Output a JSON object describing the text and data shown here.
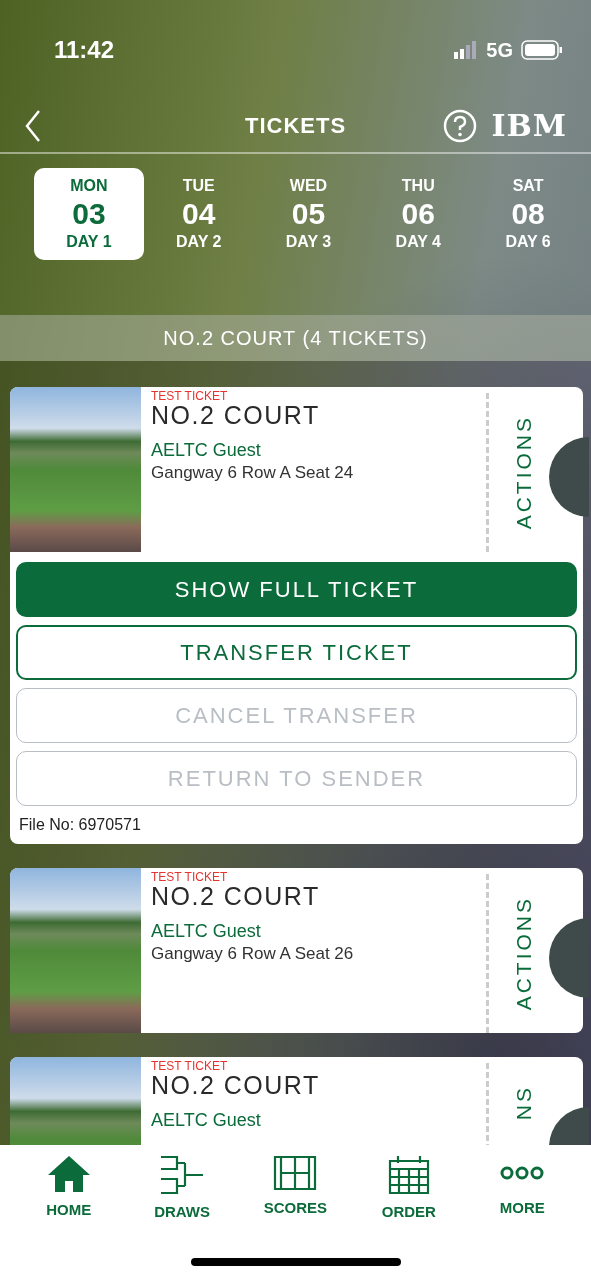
{
  "status_bar": {
    "time": "11:42",
    "network": "5G"
  },
  "header": {
    "title": "TICKETS",
    "logo": "IBM"
  },
  "days": [
    {
      "weekday": "MON",
      "date": "03",
      "day": "DAY 1",
      "selected": true
    },
    {
      "weekday": "TUE",
      "date": "04",
      "day": "DAY 2",
      "selected": false
    },
    {
      "weekday": "WED",
      "date": "05",
      "day": "DAY 3",
      "selected": false
    },
    {
      "weekday": "THU",
      "date": "06",
      "day": "DAY 4",
      "selected": false
    },
    {
      "weekday": "SAT",
      "date": "08",
      "day": "DAY 6",
      "selected": false
    }
  ],
  "section_title": "NO.2 COURT (4 TICKETS)",
  "tickets": [
    {
      "tag": "TEST TICKET",
      "court": "NO.2 COURT",
      "holder": "AELTC Guest",
      "seat": "Gangway 6 Row A Seat 24",
      "actions_label": "ACTIONS",
      "expanded": true,
      "buttons": [
        {
          "label": "SHOW FULL TICKET",
          "kind": "primary"
        },
        {
          "label": "TRANSFER TICKET",
          "kind": "outline"
        },
        {
          "label": "CANCEL TRANSFER",
          "kind": "disabled"
        },
        {
          "label": "RETURN TO SENDER",
          "kind": "disabled"
        }
      ],
      "file_no": "File No: 6970571"
    },
    {
      "tag": "TEST TICKET",
      "court": "NO.2 COURT",
      "holder": "AELTC Guest",
      "seat": "Gangway 6 Row A Seat 26",
      "actions_label": "ACTIONS",
      "expanded": false
    },
    {
      "tag": "TEST TICKET",
      "court": "NO.2 COURT",
      "holder": "AELTC Guest",
      "actions_label": "NS",
      "expanded": false
    }
  ],
  "nav": [
    {
      "label": "HOME",
      "kind": "home"
    },
    {
      "label": "DRAWS",
      "kind": "draws"
    },
    {
      "label": "SCORES",
      "kind": "scores"
    },
    {
      "label": "ORDER",
      "kind": "order"
    },
    {
      "label": "MORE",
      "kind": "more"
    }
  ]
}
